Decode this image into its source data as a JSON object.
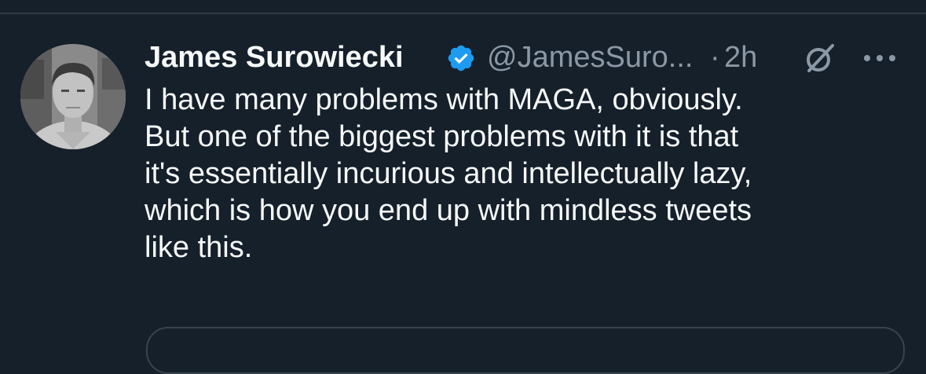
{
  "tweet": {
    "author": {
      "display_name": "James Surowiecki",
      "handle": "@JamesSuro...",
      "verified": true,
      "avatar_icon": "profile-photo"
    },
    "separator": "·",
    "timestamp": "2h",
    "header_icons": [
      "verified-badge-icon",
      "grok-icon",
      "more-options-icon"
    ],
    "text_lines": [
      "I have many problems with MAGA, obviously.",
      "But one of the biggest problems with it is that",
      "it's essentially incurious and intellectually lazy,",
      "which is how you end up with mindless tweets",
      "like this."
    ]
  },
  "colors": {
    "background": "#15202b",
    "text_primary": "#f7f9f9",
    "text_secondary": "#8b98a5",
    "verified_blue": "#1d9bf0",
    "border": "#38444d"
  }
}
